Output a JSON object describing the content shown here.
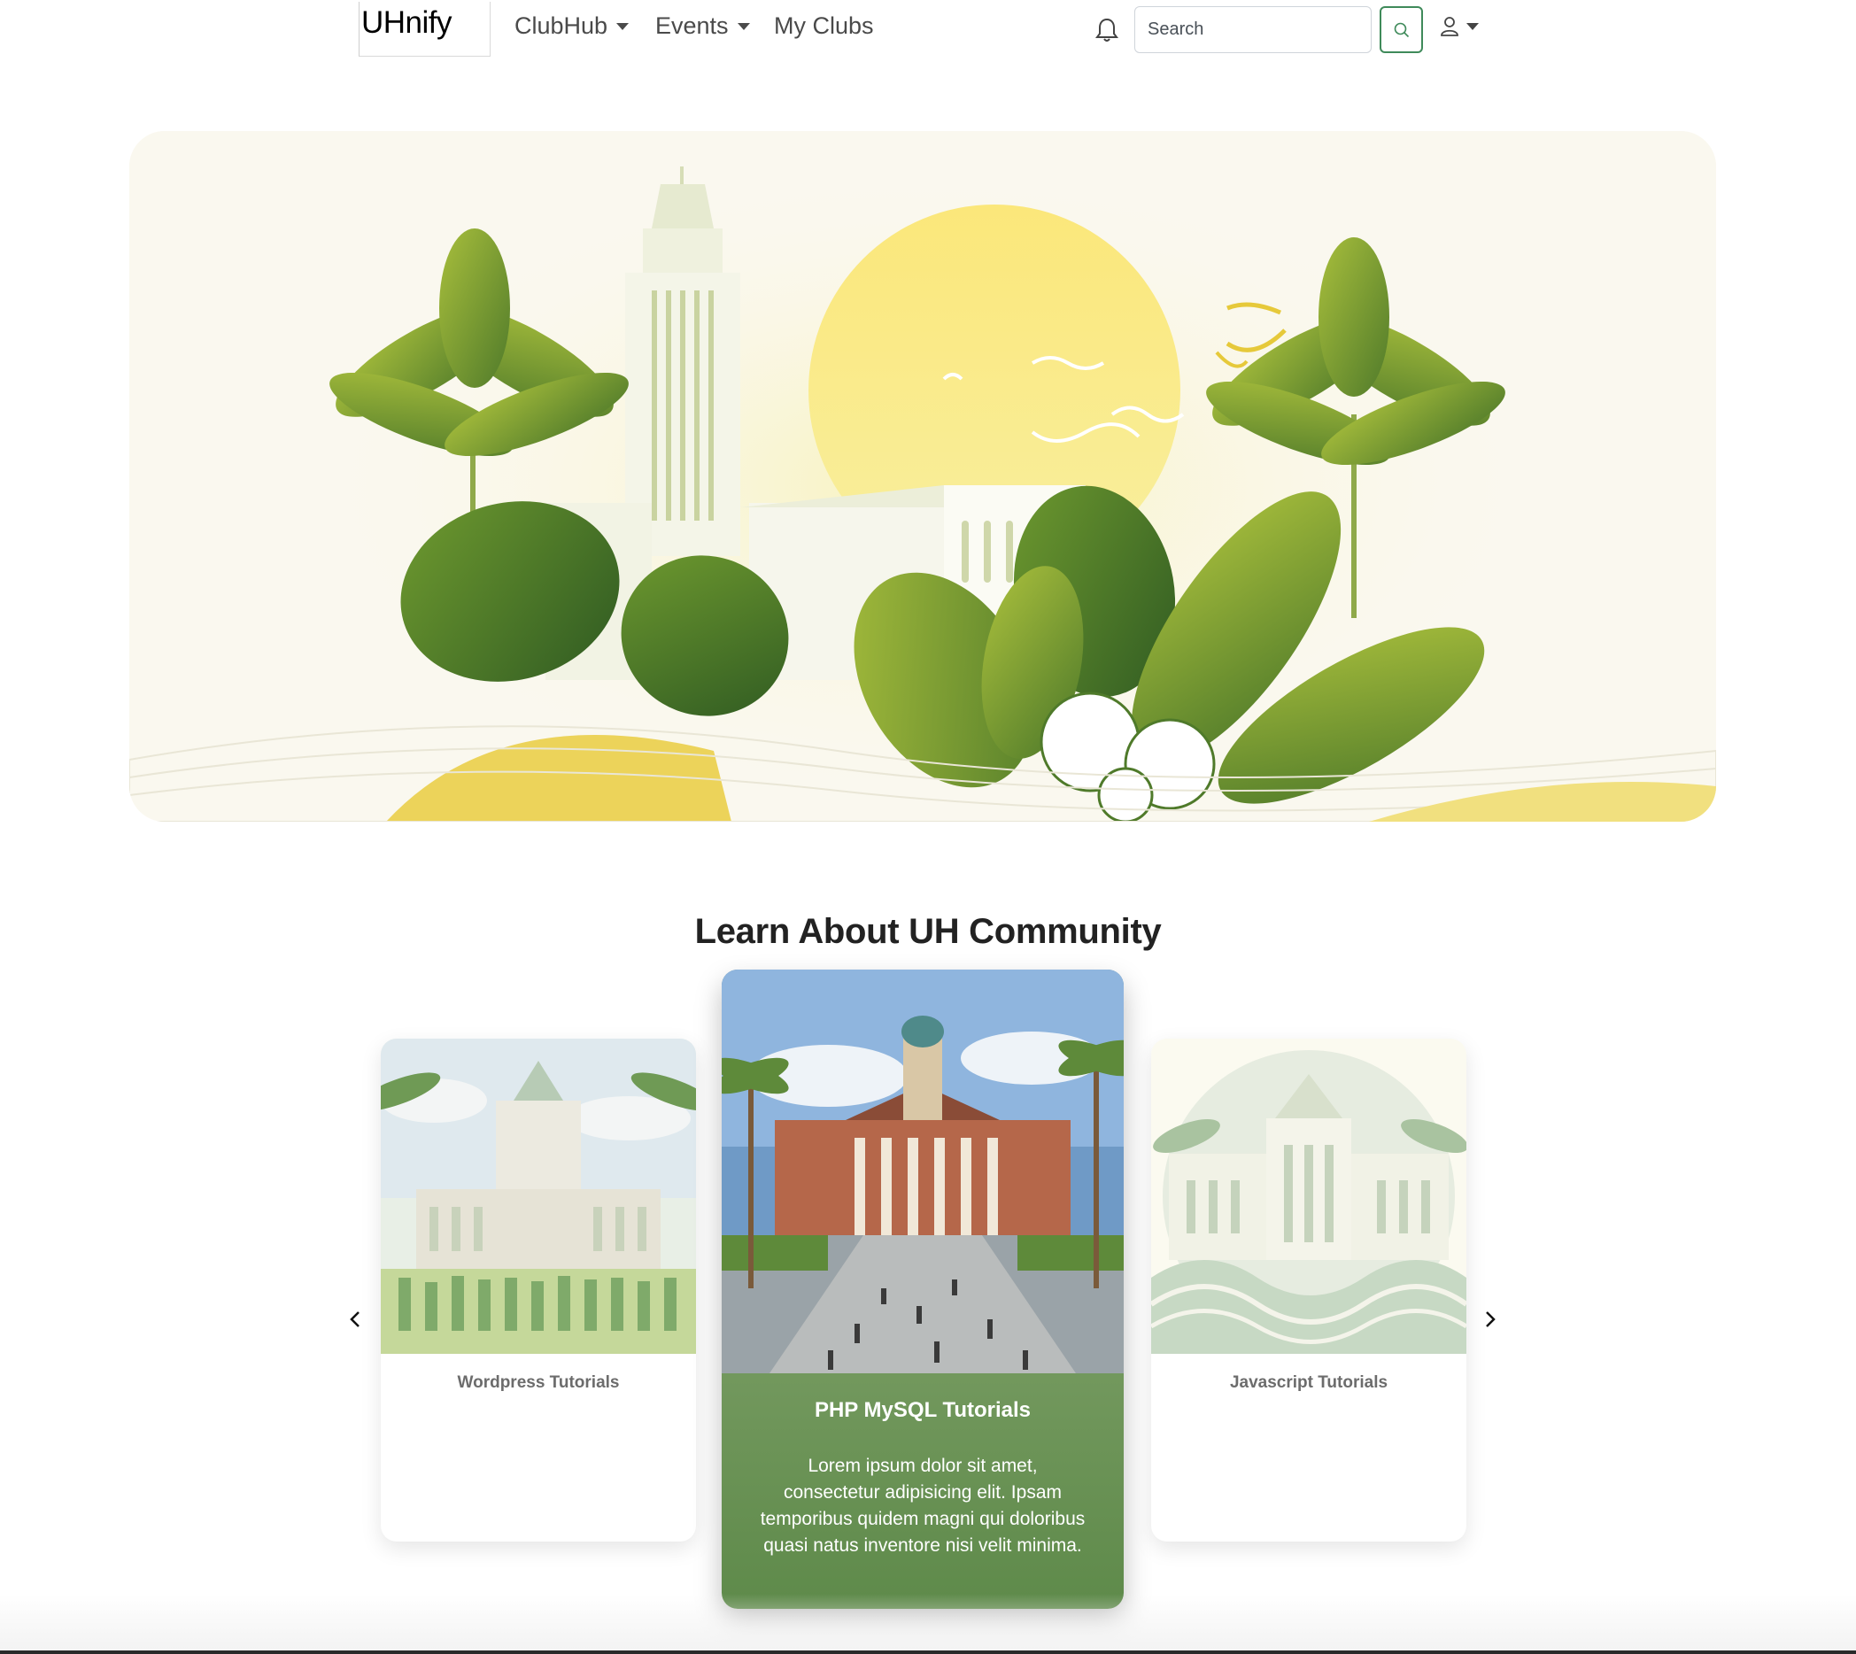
{
  "navbar": {
    "brand": "UHnify",
    "links": [
      {
        "label": "ClubHub",
        "dropdown": true
      },
      {
        "label": "Events",
        "dropdown": true
      },
      {
        "label": "My Clubs",
        "dropdown": false
      }
    ],
    "search_placeholder": "Search",
    "icons": {
      "notifications": "bell-icon",
      "search": "search-icon",
      "user": "user-icon"
    }
  },
  "hero": {
    "alt": "University campus illustration with palm trees and tropical leaves"
  },
  "section": {
    "title": "Learn About UH Community"
  },
  "carousel": {
    "cards": [
      {
        "title": "Wordpress Tutorials",
        "text": ""
      },
      {
        "title": "PHP MySQL Tutorials",
        "text": "Lorem ipsum dolor sit amet, consectetur adipisicing elit. Ipsam temporibus quidem magni qui doloribus quasi natus inventore nisi velit minima."
      },
      {
        "title": "Javascript Tutorials",
        "text": ""
      }
    ],
    "prev_icon": "chevron-left-icon",
    "next_icon": "chevron-right-icon"
  },
  "colors": {
    "accent_green": "#3f8a5a",
    "card_gradient_top": "#95b07e",
    "card_gradient_bottom": "#5e8a4a",
    "hero_bg": "#faf8ef",
    "sun_yellow": "#f8e57a"
  }
}
